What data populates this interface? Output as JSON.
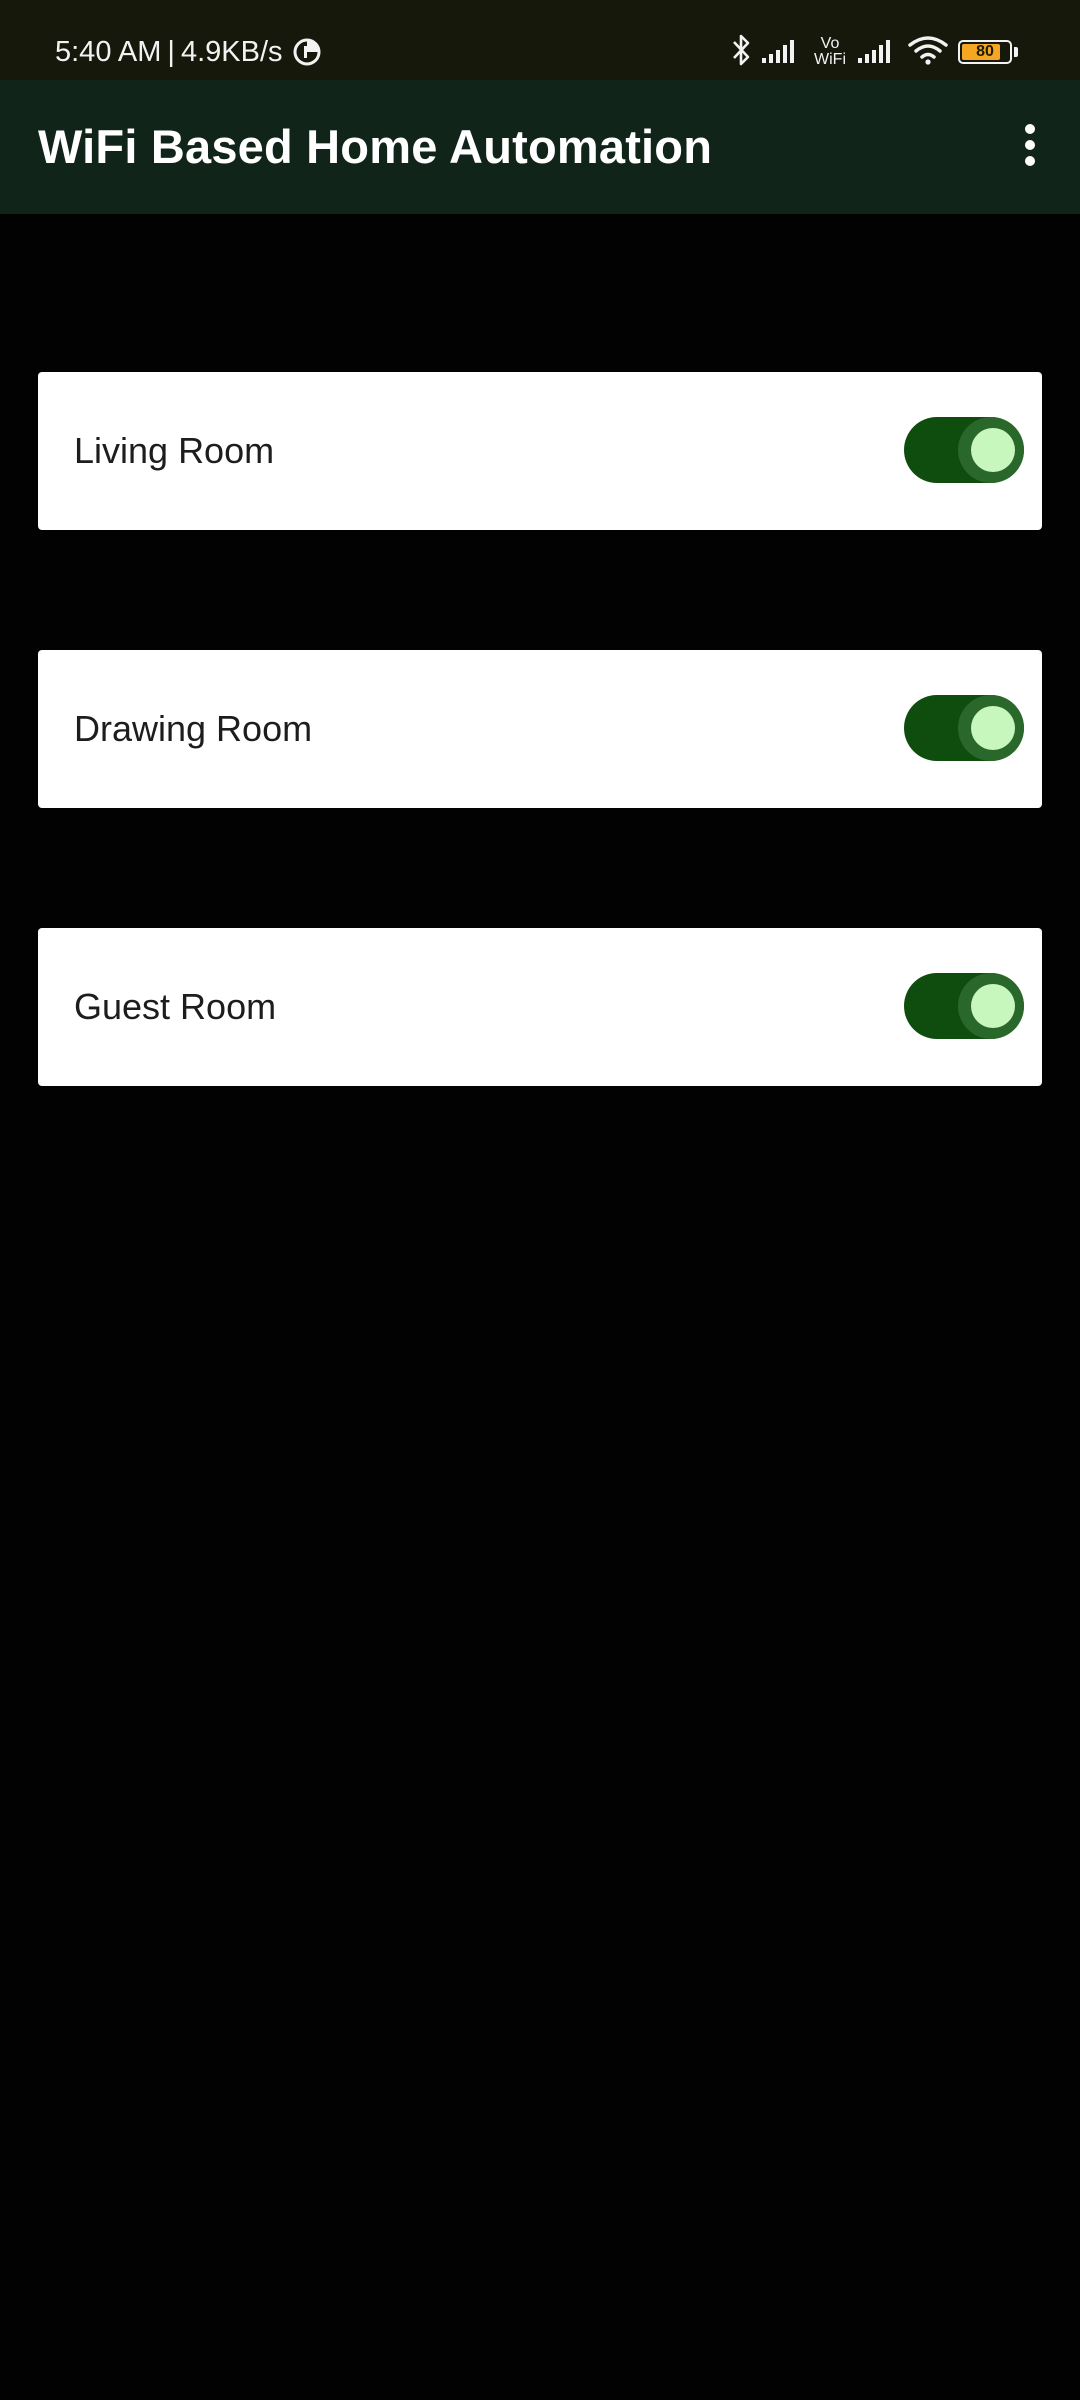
{
  "status_bar": {
    "time": "5:40 AM",
    "separator": "|",
    "network_speed": "4.9KB/s",
    "vowifi_top": "Vo",
    "vowifi_bottom": "WiFi",
    "battery_level": "80",
    "icons": [
      "data-saver-icon",
      "bluetooth-icon",
      "signal-icon",
      "vowifi-icon",
      "signal-icon",
      "wifi-icon",
      "battery-icon"
    ]
  },
  "app_bar": {
    "title": "WiFi Based Home Automation",
    "overflow_icon": "more-vert-icon",
    "color": "#10241a"
  },
  "rooms": [
    {
      "label": "Living Room",
      "on": true
    },
    {
      "label": "Drawing Room",
      "on": true
    },
    {
      "label": "Guest Room",
      "on": true
    }
  ],
  "colors": {
    "switch_track": "#0e4d0e",
    "switch_thumb": "#c8f7bd",
    "card": "#ffffff",
    "background": "#020202"
  }
}
